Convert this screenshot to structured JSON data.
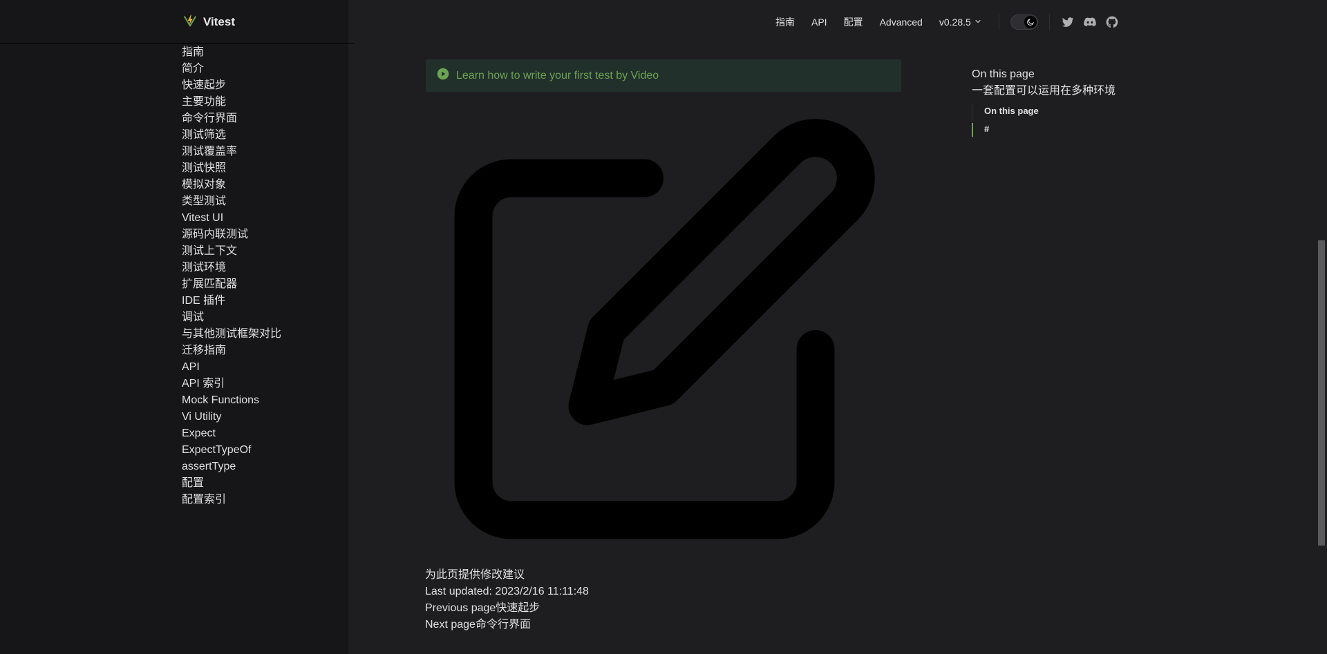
{
  "brand": {
    "title": "Vitest",
    "icon": "vitest-logo-icon"
  },
  "sidebar": {
    "items": [
      {
        "label": "指南"
      },
      {
        "label": "简介"
      },
      {
        "label": "快速起步"
      },
      {
        "label": "主要功能"
      },
      {
        "label": "命令行界面"
      },
      {
        "label": "测试筛选"
      },
      {
        "label": "测试覆盖率"
      },
      {
        "label": "测试快照"
      },
      {
        "label": "模拟对象"
      },
      {
        "label": "类型测试"
      },
      {
        "label": "Vitest UI"
      },
      {
        "label": "源码内联测试"
      },
      {
        "label": "测试上下文"
      },
      {
        "label": "测试环境"
      },
      {
        "label": "扩展匹配器"
      },
      {
        "label": "IDE 插件"
      },
      {
        "label": "调试"
      },
      {
        "label": "与其他测试框架对比"
      },
      {
        "label": "迁移指南"
      },
      {
        "label": "API"
      },
      {
        "label": "API 索引"
      },
      {
        "label": "Mock Functions"
      },
      {
        "label": "Vi Utility"
      },
      {
        "label": "Expect"
      },
      {
        "label": "ExpectTypeOf"
      },
      {
        "label": "assertType"
      },
      {
        "label": "配置"
      },
      {
        "label": "配置索引"
      }
    ]
  },
  "topnav": {
    "guide": "指南",
    "api": "API",
    "config": "配置",
    "advanced": "Advanced",
    "version": "v0.28.5",
    "icons": [
      "chevron-down-icon",
      "moon-icon",
      "twitter-icon",
      "discord-icon",
      "github-icon"
    ]
  },
  "banner": {
    "text": "Learn how to write your first test by Video",
    "icon": "play-circle-icon",
    "accent": "#6ca454",
    "background": "#22302b"
  },
  "illustration": {
    "icon": "edit-icon"
  },
  "footer": {
    "edit_link": "为此页提供修改建议",
    "last_updated": "Last updated: 2023/2/16 11:11:48",
    "prev": "Previous page快速起步",
    "next": "Next page命令行界面"
  },
  "outline": {
    "title": "On this page",
    "heading": "一套配置可以运用在多种环境",
    "sub_title": "On this page",
    "anchor": "#"
  },
  "colors": {
    "page_bg": "#1e1e20",
    "sidebar_bg": "#161618",
    "accent": "#6ca454"
  }
}
